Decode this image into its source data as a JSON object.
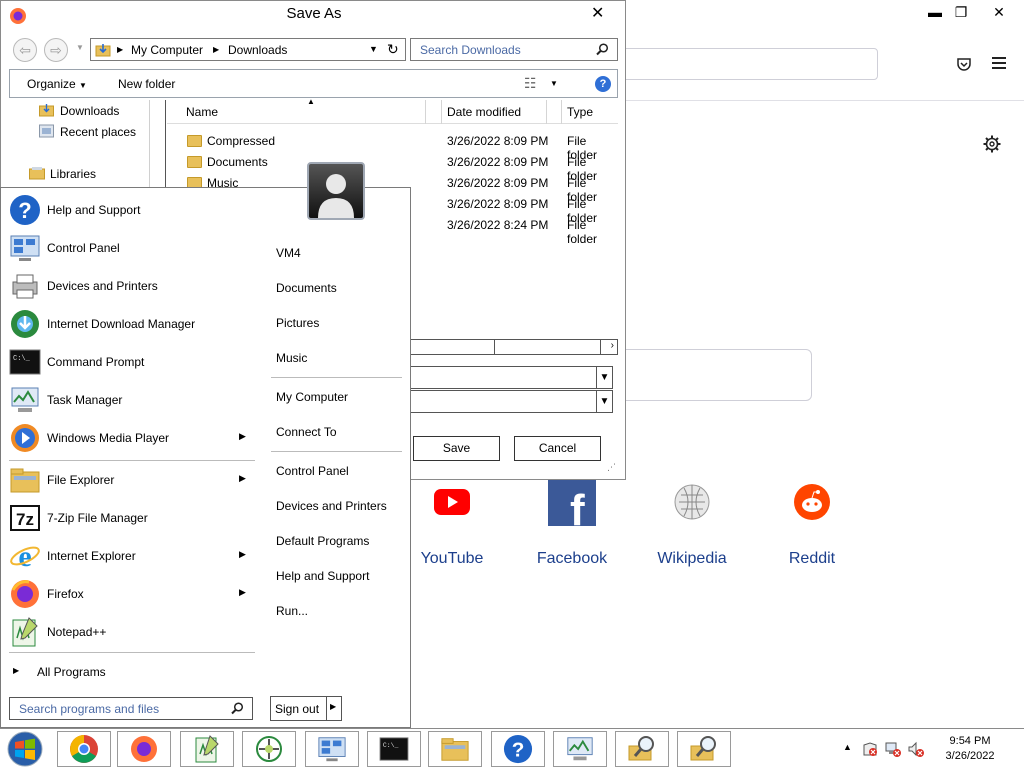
{
  "firefox": {
    "window_controls": {
      "minimize": "▬",
      "restore": "❐",
      "close": "✕"
    },
    "shortcuts": [
      {
        "label": "YouTube",
        "icon": "youtube-icon"
      },
      {
        "label": "Facebook",
        "icon": "facebook-icon"
      },
      {
        "label": "Wikipedia",
        "icon": "wikipedia-icon"
      },
      {
        "label": "Reddit",
        "icon": "reddit-icon"
      }
    ],
    "colors": {
      "shortcut_text": "#1c3f8c",
      "youtube": "#ff0000",
      "facebook": "#3b5998",
      "reddit": "#ff4500"
    }
  },
  "dialog": {
    "title": "Save As",
    "close": "✕",
    "address": [
      "My Computer",
      "Downloads"
    ],
    "search_placeholder": "Search Downloads",
    "toolbar": {
      "organize": "Organize",
      "new_folder": "New folder"
    },
    "nav_pane": [
      "Downloads",
      "Recent places",
      "Libraries"
    ],
    "columns": [
      "Name",
      "Date modified",
      "Type"
    ],
    "rows": [
      {
        "name": "Compressed",
        "date": "3/26/2022 8:09 PM",
        "type": "File folder"
      },
      {
        "name": "Documents",
        "date": "3/26/2022 8:09 PM",
        "type": "File folder"
      },
      {
        "name": "Music",
        "date": "3/26/2022 8:09 PM",
        "type": "File folder"
      },
      {
        "name": "",
        "date": "3/26/2022 8:09 PM",
        "type": "File folder"
      },
      {
        "name": "",
        "date": "3/26/2022 8:24 PM",
        "type": "File folder"
      }
    ],
    "buttons": {
      "save": "Save",
      "cancel": "Cancel"
    }
  },
  "start_menu": {
    "left_items": [
      {
        "label": "Help and Support",
        "icon": "help-icon",
        "submenu": false
      },
      {
        "label": "Control Panel",
        "icon": "control-panel-icon",
        "submenu": false
      },
      {
        "label": "Devices and Printers",
        "icon": "printer-icon",
        "submenu": false
      },
      {
        "label": "Internet Download Manager",
        "icon": "idm-icon",
        "submenu": false
      },
      {
        "label": "Command Prompt",
        "icon": "cmd-icon",
        "submenu": false
      },
      {
        "label": "Task Manager",
        "icon": "task-manager-icon",
        "submenu": false
      },
      {
        "label": "Windows Media Player",
        "icon": "media-player-icon",
        "submenu": true
      },
      {
        "label": "File Explorer",
        "icon": "folder-icon",
        "submenu": true
      },
      {
        "label": "7-Zip File Manager",
        "icon": "7zip-icon",
        "submenu": false
      },
      {
        "label": "Internet Explorer",
        "icon": "ie-icon",
        "submenu": true
      },
      {
        "label": "Firefox",
        "icon": "firefox-icon",
        "submenu": true
      },
      {
        "label": "Notepad++",
        "icon": "notepadpp-icon",
        "submenu": false
      }
    ],
    "all_programs": "All Programs",
    "search_placeholder": "Search programs and files",
    "right_items": [
      "VM4",
      "Documents",
      "Pictures",
      "Music",
      "My Computer",
      "Connect To",
      "Control Panel",
      "Devices and Printers",
      "Default Programs",
      "Help and Support",
      "Run..."
    ],
    "sign_out": "Sign out"
  },
  "taskbar": {
    "apps": [
      "Chrome",
      "Firefox",
      "Notepad++",
      "Network Tool",
      "Control Panel",
      "Command Prompt",
      "File Explorer",
      "Help",
      "Task Manager",
      "Search Tool 1",
      "Search Tool 2"
    ],
    "time": "9:54 PM",
    "date": "3/26/2022"
  }
}
